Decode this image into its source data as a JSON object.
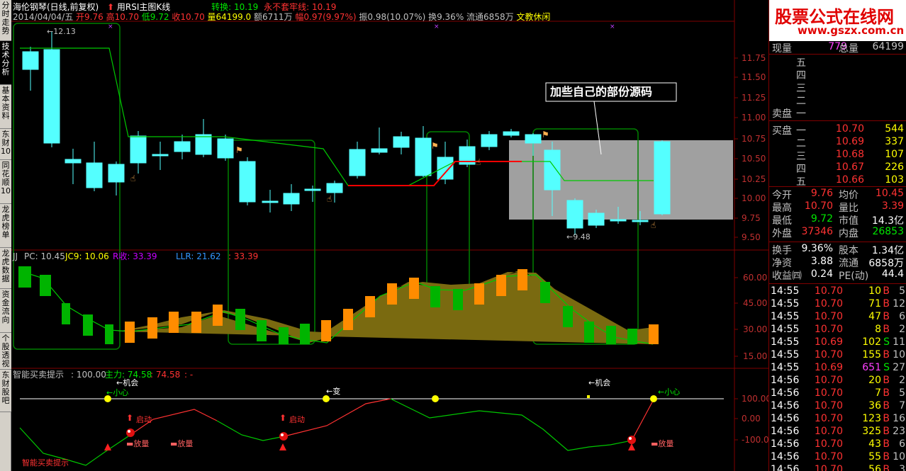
{
  "side_tabs": [
    "分时走势",
    "技术分析",
    "基本资料",
    "东财10",
    "同花顺10",
    "龙虎榜单",
    "龙虎数据",
    "资金流向",
    "个股透视",
    "东财股吧"
  ],
  "header": {
    "stock_name": "海伦钢琴(日线,前复权)",
    "rsi_label": "用RSI主图K线",
    "zhuanhuan": "转换: 10.19",
    "yongbu": "永不套牢线: 10.19",
    "date": "2014/04/04/五",
    "open": "开9.76",
    "high": "高10.70",
    "low": "低9.72",
    "close": "收10.70",
    "vol": "量64199.0",
    "amount": "额6711万",
    "change": "幅0.97(9.97%)",
    "zhenfu": "振0.98(10.07%)",
    "huanshou": "换9.36%",
    "liutong": "流通6858万",
    "sector": "文教休闲"
  },
  "main_chart": {
    "price_axis": [
      "11.75",
      "11.50",
      "11.25",
      "11.00",
      "10.75",
      "10.50",
      "10.25",
      "10.00",
      "9.75",
      "9.50"
    ],
    "max_label": "12.13",
    "min_label": "9.48",
    "annotation": "加些自己的部份源码"
  },
  "indicator_panel": {
    "title": "JJ",
    "pc": "PC: 10.45",
    "jc9": "JC9: 10.06",
    "r": "R收: 33.39",
    "llr": "LLR: 21.62",
    "extra": ": 33.39",
    "axis": [
      "60.00",
      "45.00",
      "30.00",
      "15.00"
    ]
  },
  "signal_panel": {
    "title": "智能买卖提示",
    "value": ": 100.00",
    "zhuli": "主力: 74.58",
    "second": ": 74.58",
    "dash": ": -",
    "axis": [
      "100.00",
      "0.00",
      "-100.00"
    ],
    "labels": {
      "xiaoxin1": "小心",
      "xiaoxin2": "小心",
      "bian": "变",
      "jihui1": "机会",
      "jihui2": "机会",
      "qidong1": "启动",
      "qidong2": "启动",
      "fangliang1": "放量",
      "fangliang2": "放量",
      "fangliang3": "放量",
      "bottom_label": "智能买卖提示"
    }
  },
  "logo": {
    "main": "股票公式在线网",
    "sub": "www.gszx.com.cn"
  },
  "quote": {
    "xianliang_label": "现量",
    "xianliang": "779",
    "zongliang_label": "总量",
    "zongliang": "64199",
    "sell_labels": [
      "五",
      "四",
      "三",
      "二",
      "一"
    ],
    "sell_title": "卖盘",
    "buy_title": "买盘",
    "buy": [
      {
        "lvl": "一",
        "price": "10.70",
        "vol": "544"
      },
      {
        "lvl": "二",
        "price": "10.69",
        "vol": "337"
      },
      {
        "lvl": "三",
        "price": "10.68",
        "vol": "107"
      },
      {
        "lvl": "四",
        "price": "10.67",
        "vol": "226"
      },
      {
        "lvl": "五",
        "price": "10.66",
        "vol": "103"
      }
    ],
    "stats": [
      {
        "l1": "今开",
        "v1": "9.76",
        "l2": "均价",
        "v2": "10.45"
      },
      {
        "l1": "最高",
        "v1": "10.70",
        "l2": "量比",
        "v2": "3.39"
      },
      {
        "l1": "最低",
        "v1": "9.72",
        "l2": "市值",
        "v2": "14.3亿"
      },
      {
        "l1": "外盘",
        "v1": "37346",
        "l2": "内盘",
        "v2": "26853"
      }
    ],
    "stats2": [
      {
        "l1": "换手",
        "v1": "9.36%",
        "l2": "股本",
        "v2": "1.34亿"
      },
      {
        "l1": "净资",
        "v1": "3.88",
        "l2": "流通",
        "v2": "6858万"
      },
      {
        "l1": "收益㈣",
        "v1": "0.24",
        "l2": "PE(动)",
        "v2": "44.4"
      }
    ],
    "ticks": [
      {
        "t": "14:55",
        "p": "10.70",
        "v": "10",
        "s": "B",
        "n": "5"
      },
      {
        "t": "14:55",
        "p": "10.70",
        "v": "71",
        "s": "B",
        "n": "12"
      },
      {
        "t": "14:55",
        "p": "10.70",
        "v": "47",
        "s": "B",
        "n": "6"
      },
      {
        "t": "14:55",
        "p": "10.70",
        "v": "8",
        "s": "B",
        "n": "2"
      },
      {
        "t": "14:55",
        "p": "10.69",
        "v": "102",
        "s": "S",
        "n": "11"
      },
      {
        "t": "14:55",
        "p": "10.70",
        "v": "155",
        "s": "B",
        "n": "10"
      },
      {
        "t": "14:55",
        "p": "10.69",
        "v": "651",
        "s": "S",
        "n": "27"
      },
      {
        "t": "14:56",
        "p": "10.70",
        "v": "20",
        "s": "B",
        "n": "2"
      },
      {
        "t": "14:56",
        "p": "10.70",
        "v": "7",
        "s": "B",
        "n": "5"
      },
      {
        "t": "14:56",
        "p": "10.70",
        "v": "36",
        "s": "B",
        "n": "7"
      },
      {
        "t": "14:56",
        "p": "10.70",
        "v": "123",
        "s": "B",
        "n": "16"
      },
      {
        "t": "14:56",
        "p": "10.70",
        "v": "325",
        "s": "B",
        "n": "23"
      },
      {
        "t": "14:56",
        "p": "10.70",
        "v": "43",
        "s": "B",
        "n": "6"
      },
      {
        "t": "14:56",
        "p": "10.70",
        "v": "55",
        "s": "B",
        "n": "10"
      },
      {
        "t": "14:56",
        "p": "10.70",
        "v": "56",
        "s": "B",
        "n": "3"
      }
    ]
  }
}
